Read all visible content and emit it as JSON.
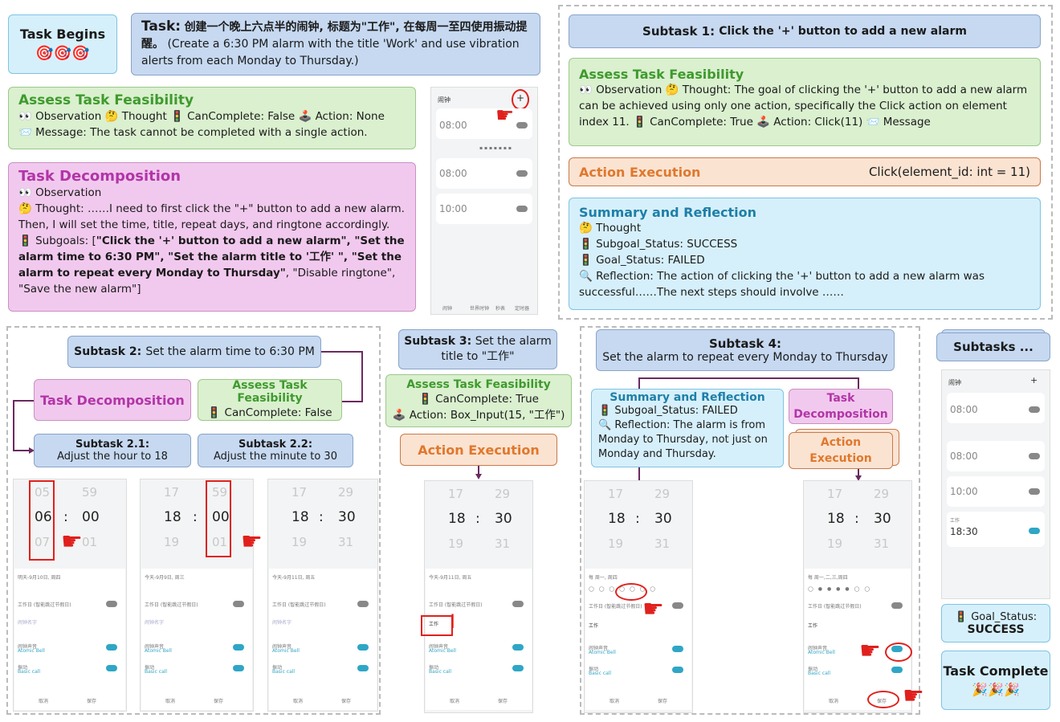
{
  "task_begins": {
    "title": "Task Begins",
    "icons": "🎯🎯🎯"
  },
  "task": {
    "label": "Task:",
    "chinese": "创建一个晚上六点半的闹钟, 标题为\"工作\", 在每周一至四使用振动提醒。",
    "english": "(Create a 6:30 PM alarm with the title 'Work' and use vibration alerts from each Monday to Thursday.)"
  },
  "feasibility_main": {
    "title": "Assess Task Feasibility",
    "line1": "👀 Observation  🤔 Thought  🚦 CanComplete: False  🕹️ Action: None",
    "line2": "📨 Message: The task cannot be completed with a single action."
  },
  "decomposition_main": {
    "title": "Task Decomposition",
    "observation": "👀 Observation",
    "thought": "🤔 Thought: ……I need to first click the \"+\" button to add a new alarm. Then, I will set the time, title, repeat days, and ringtone accordingly.",
    "subgoals_prefix": "🚦 Subgoals: [",
    "subgoals_bold": "\"Click the '+' button to add a new alarm\", \"Set the alarm time to 6:30 PM\", \"Set the alarm title to '工作' \", \"Set the alarm to repeat every Monday to Thursday\"",
    "subgoals_rest": ", \"Disable ringtone\", \"Save the new alarm\"]"
  },
  "phone_main": {
    "title": "闹钟",
    "plus": "+",
    "times": [
      "08:00",
      "08:00",
      "10:00"
    ],
    "tabs": [
      "闹钟",
      "世界时钟",
      "秒表",
      "定时器"
    ]
  },
  "subtask1": {
    "label": "Subtask 1:",
    "text": "Click the '+' button to add a new alarm",
    "feasibility_title": "Assess Task Feasibility",
    "feasibility_text": "👀 Observation  🤔 Thought: The goal of clicking the '+' button to add a new alarm can be achieved using only one action, specifically the Click action on element index 11.  🚦 CanComplete: True  🕹️ Action: Click(11)  📨 Message",
    "action_title": "Action Execution",
    "action_code": "Click(element_id: int = 11)",
    "summary_title": "Summary and Reflection",
    "summary_thought": "🤔 Thought",
    "summary_subgoal": "🚦 Subgoal_Status: SUCCESS",
    "summary_goal": "🚦 Goal_Status: FAILED",
    "summary_reflection": "🔍 Reflection: The action of clicking the '+' button to add a new alarm was successful……The next steps should involve ……"
  },
  "subtask2": {
    "label": "Subtask 2:",
    "text": "Set the alarm time to 6:30 PM",
    "decomp": "Task Decomposition",
    "feas_title": "Assess Task Feasibility",
    "feas_text": "🚦 CanComplete: False",
    "sub21_label": "Subtask 2.1:",
    "sub21_text": "Adjust the hour to 18",
    "sub22_label": "Subtask 2.2:",
    "sub22_text": "Adjust the minute to 30"
  },
  "subtask3": {
    "label": "Subtask 3:",
    "text": "Set the alarm title to \"工作\"",
    "feas_title": "Assess Task Feasibility",
    "feas_can": "🚦 CanComplete: True",
    "feas_action": "🕹️ Action: Box_Input(15, \"工作\")",
    "action": "Action Execution"
  },
  "subtask4": {
    "label": "Subtask 4:",
    "text": "Set the alarm to repeat every Monday to Thursday",
    "summary_title": "Summary and Reflection",
    "summary_status": "🚦 Subgoal_Status: FAILED",
    "summary_reflection": "🔍 Reflection: The alarm is from Monday to Thursday, not just on Monday and Thursday.",
    "decomp": "Task Decomposition",
    "action": "Action Execution"
  },
  "final": {
    "subtasks": "Subtasks ...",
    "goal_status_label": "🚦 Goal_Status:",
    "goal_status_value": "SUCCESS",
    "complete": "Task Complete",
    "complete_icons": "🎉🎉🎉",
    "phone_title": "闹钟",
    "phone_times": [
      "08:00",
      "08:00",
      "10:00",
      "18:30"
    ],
    "phone_label": "工作"
  },
  "pickers": {
    "p1": {
      "top": [
        "05",
        "59"
      ],
      "mid": [
        "06",
        "00"
      ],
      "bot": [
        "07",
        "01"
      ]
    },
    "p2": {
      "top": [
        "17",
        "59"
      ],
      "mid": [
        "18",
        "00"
      ],
      "bot": [
        "19",
        "01"
      ]
    },
    "p3": {
      "top": [
        "17",
        "29"
      ],
      "mid": [
        "18",
        "30"
      ],
      "bot": [
        "19",
        "31"
      ]
    },
    "colon": ":"
  },
  "form": {
    "date1": "明天-9月10日, 周四",
    "date2": "今天-9月9日, 周三",
    "date3": "今天-9月11日, 周五",
    "date4": "每 周一, 周四",
    "date5": "每 周一,二,三,周四",
    "workday": "工作日 (智能跳过节假日)",
    "name_placeholder": "闹钟名字",
    "name_value": "工作",
    "ring_label": "闹钟声音",
    "ring_value": "Atomic Bell",
    "vib_label": "振动",
    "vib_value": "Basic call",
    "cancel": "取消",
    "save": "保存",
    "weekdays": [
      "日",
      "一",
      "二",
      "三",
      "四",
      "五",
      "六"
    ]
  }
}
